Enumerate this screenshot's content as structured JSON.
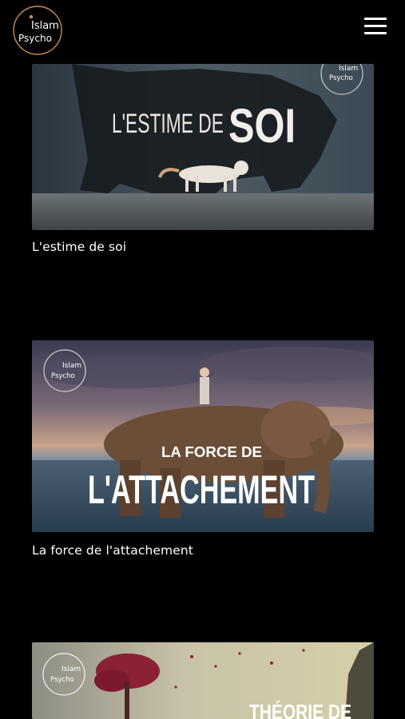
{
  "header": {
    "logo_text_top": "Islam",
    "logo_text_bottom": "Psycho",
    "menu_icon": "hamburger-menu-icon"
  },
  "colors": {
    "background": "#000000",
    "logo_accent": "#c98a58",
    "text": "#ffffff"
  },
  "videos": [
    {
      "title": "L'estime de soi",
      "thumb_text_small": "L'ESTIME DE",
      "thumb_text_big": "SOI"
    },
    {
      "title": "La force de l'attachement",
      "thumb_text_small": "LA FORCE DE",
      "thumb_text_big": "L'ATTACHEMENT"
    },
    {
      "title": "",
      "thumb_text_small": "",
      "thumb_text_big": "THÉORIE DE"
    }
  ]
}
